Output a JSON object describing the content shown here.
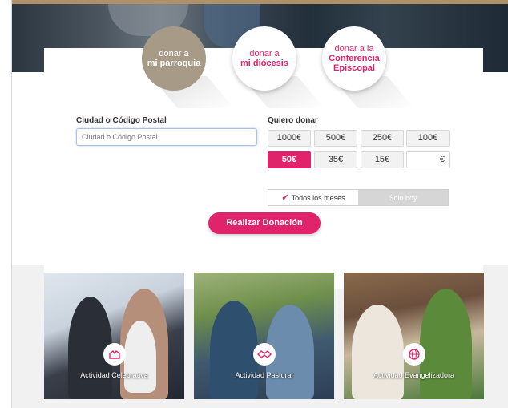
{
  "tabs": {
    "parroquia": {
      "line1": "donar a",
      "line2": "mi parroquia"
    },
    "diocesis": {
      "line1": "donar a",
      "line2": "mi diócesis"
    },
    "conferencia": {
      "line1": "donar a la",
      "line2": "Conferencia",
      "line3": "Episcopal"
    }
  },
  "form": {
    "city_label": "Ciudad o Código Postal",
    "city_placeholder": "Ciudad o Código Postal",
    "donate_label": "Quiero donar",
    "amounts": [
      "1000€",
      "500€",
      "250€",
      "100€",
      "50€",
      "35€",
      "15€"
    ],
    "selected_amount": "50€",
    "currency_symbol": "€"
  },
  "frequency": {
    "monthly": "Todos los meses",
    "once": "Solo hoy",
    "selected": "monthly"
  },
  "submit_label": "Realizar Donación",
  "activities": [
    {
      "caption": "Actividad Celebrativa",
      "icon": "hands-icon"
    },
    {
      "caption": "Actividad Pastoral",
      "icon": "handshake-icon"
    },
    {
      "caption": "Actividad Evangelizadora",
      "icon": "globe-icon"
    }
  ],
  "colors": {
    "accent": "#e0236a",
    "tab_active": "#a79a87"
  }
}
